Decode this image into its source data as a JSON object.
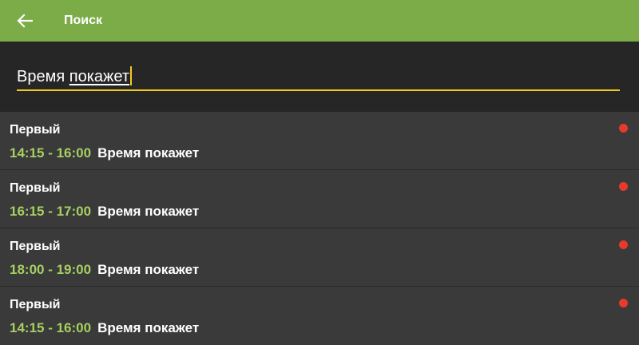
{
  "appbar": {
    "title": "Поиск",
    "back_icon": "arrow-left-icon"
  },
  "search": {
    "word1": "Время ",
    "word2": "покажет",
    "accent_color": "#f2cc1b"
  },
  "colors": {
    "appbar_bg": "#7cac48",
    "time_color": "#a6d061",
    "status_dot": "#e8392d"
  },
  "results": [
    {
      "channel": "Первый",
      "time": "14:15 - 16:00",
      "title": "Время покажет",
      "status_icon": "red-dot-icon"
    },
    {
      "channel": "Первый",
      "time": "16:15 - 17:00",
      "title": "Время покажет",
      "status_icon": "red-dot-icon"
    },
    {
      "channel": "Первый",
      "time": "18:00 - 19:00",
      "title": "Время покажет",
      "status_icon": "red-dot-icon"
    },
    {
      "channel": "Первый",
      "time": "14:15 - 16:00",
      "title": "Время покажет",
      "status_icon": "red-dot-icon"
    }
  ]
}
